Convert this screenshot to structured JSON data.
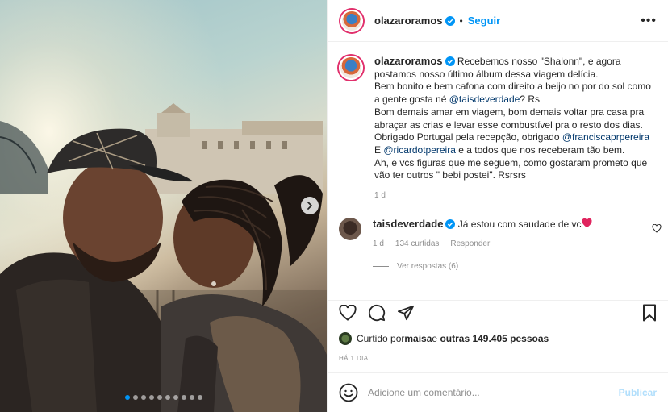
{
  "post": {
    "username": "olazaroramos",
    "follow_label": "Seguir",
    "more_label": "•••",
    "separator": "•",
    "caption": {
      "line1_prefix": "Recebemos nosso \"Shalonn\", e agora postamos nosso último álbum dessa viagem delícia.",
      "line2": "Bem bonito e bem cafona com direito a beijo no por do sol como a gente gosta né ",
      "mention1": "@taisdeverdade",
      "line2_suffix": "? Rs",
      "line3": "Bom demais amar em viagem, bom demais voltar pra casa pra abraçar as crias e levar esse combustível pra o resto dos dias.",
      "line4": "Obrigado Portugal pela recepção, obrigado ",
      "mention2": "@franciscaprpereira",
      "line5_prefix": "E ",
      "mention3": "@ricardotpereira",
      "line5_suffix": " e a todos que nos receberam tão bem.",
      "line6": "Ah, e vcs figuras que me seguem, como gostaram prometo que vão ter outros \" bebi postei\". Rsrsrs",
      "time": "1 d"
    },
    "comment": {
      "username": "taisdeverdade",
      "text": "Já estou com saudade de vc",
      "time": "1 d",
      "likes": "134 curtidas",
      "reply_label": "Responder",
      "view_replies": "Ver respostas (6)"
    },
    "likes": {
      "prefix": "Curtido por ",
      "user": "maisa",
      "middle": " e ",
      "others": "outras 149.405 pessoas"
    },
    "date": "HÁ 1 DIA",
    "add_comment_placeholder": "Adicione um comentário...",
    "publish_label": "Publicar",
    "carousel": {
      "slide_count": 10,
      "active_index": 0
    }
  },
  "colors": {
    "accent": "#0095f6",
    "mention": "#00376b",
    "muted": "#8e8e8e",
    "heart": "#ed4956"
  },
  "icons": [
    "verified-badge-icon",
    "more-icon",
    "heart-icon",
    "comment-icon",
    "share-icon",
    "bookmark-icon",
    "emoji-icon",
    "chevron-right-icon"
  ]
}
